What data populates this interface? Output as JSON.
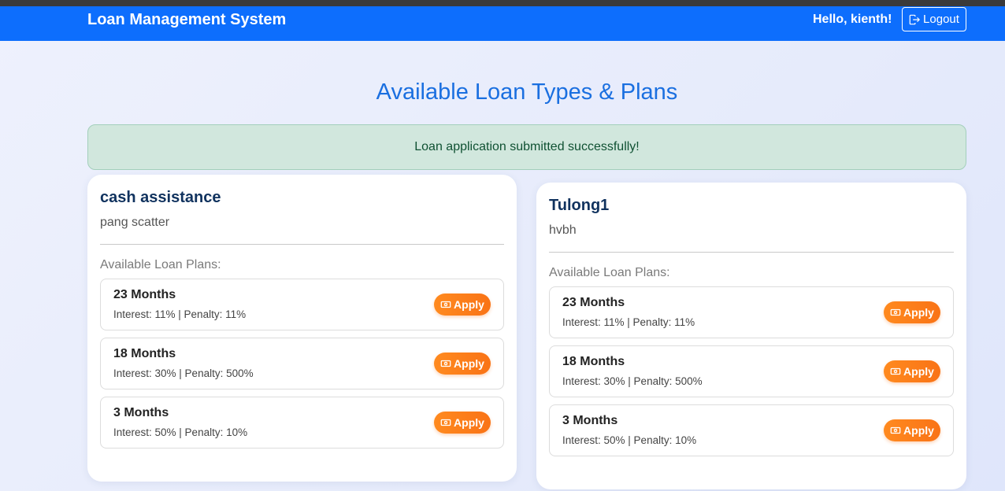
{
  "navbar": {
    "brand": "Loan Management System",
    "greeting": "Hello, kienth!",
    "logout_label": "Logout",
    "background": "#0d6efd"
  },
  "page": {
    "title": "Available Loan Types & Plans"
  },
  "alert": {
    "message": "Loan application submitted successfully!",
    "type": "success"
  },
  "loan_types": [
    {
      "name": "cash assistance",
      "description": "pang scatter",
      "plans_label": "Available Loan Plans:",
      "plans": [
        {
          "duration": "23 Months",
          "info": "Interest: 11% | Penalty: 11%",
          "apply_label": "Apply"
        },
        {
          "duration": "18 Months",
          "info": "Interest: 30% | Penalty: 500%",
          "apply_label": "Apply"
        },
        {
          "duration": "3 Months",
          "info": "Interest: 50% | Penalty: 10%",
          "apply_label": "Apply"
        }
      ]
    },
    {
      "name": "Tulong1",
      "description": "hvbh",
      "plans_label": "Available Loan Plans:",
      "plans": [
        {
          "duration": "23 Months",
          "info": "Interest: 11% | Penalty: 11%",
          "apply_label": "Apply"
        },
        {
          "duration": "18 Months",
          "info": "Interest: 30% | Penalty: 500%",
          "apply_label": "Apply"
        },
        {
          "duration": "3 Months",
          "info": "Interest: 50% | Penalty: 10%",
          "apply_label": "Apply"
        }
      ]
    }
  ],
  "colors": {
    "accent": "#0d6efd",
    "title": "#1a6fe0",
    "apply_button": "#f97316",
    "alert_bg": "#d1e7dd",
    "card_title": "#10325e"
  },
  "icons": {
    "logout": "box-arrow-right-icon",
    "apply": "cash-icon"
  }
}
